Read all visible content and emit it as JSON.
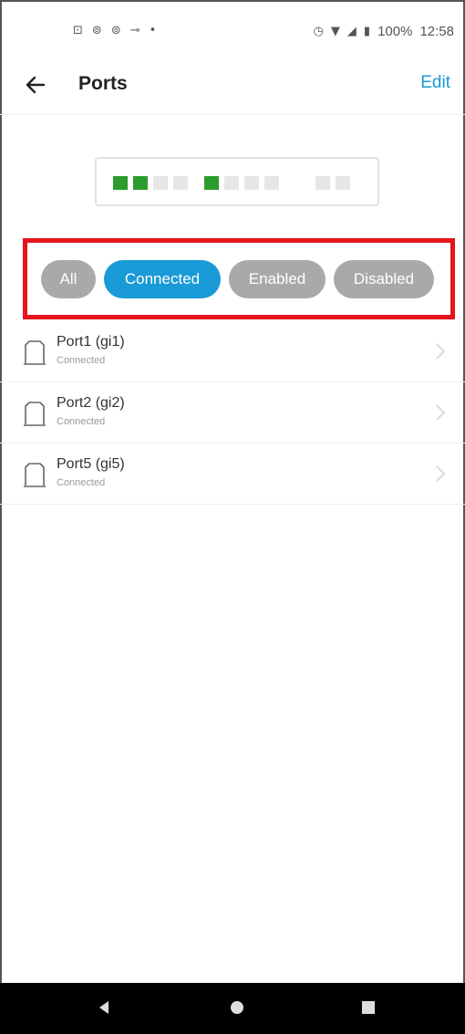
{
  "status_bar": {
    "left_icons": [
      "notification-icon",
      "notification-icon",
      "notification-icon",
      "cast-icon",
      "dot-icon"
    ],
    "battery": "100%",
    "time": "12:58"
  },
  "header": {
    "title": "Ports",
    "edit_label": "Edit"
  },
  "port_map": {
    "ports": [
      {
        "connected": true
      },
      {
        "connected": true
      },
      {
        "connected": false
      },
      {
        "connected": false
      },
      {
        "connected": true
      },
      {
        "connected": false
      },
      {
        "connected": false
      },
      {
        "connected": false
      },
      {
        "connected": false
      },
      {
        "connected": false
      }
    ],
    "color_connected": "#2c9c2c",
    "color_idle": "#e6e6e6"
  },
  "filters": {
    "all": "All",
    "connected": "Connected",
    "enabled": "Enabled",
    "disabled": "Disabled",
    "selected": "Connected",
    "accent": "#1a9ad6",
    "highlight": "#e3161d"
  },
  "ports": [
    {
      "name": "Port1 (gi1)",
      "status": "Connected"
    },
    {
      "name": "Port2 (gi2)",
      "status": "Connected"
    },
    {
      "name": "Port5 (gi5)",
      "status": "Connected"
    }
  ]
}
